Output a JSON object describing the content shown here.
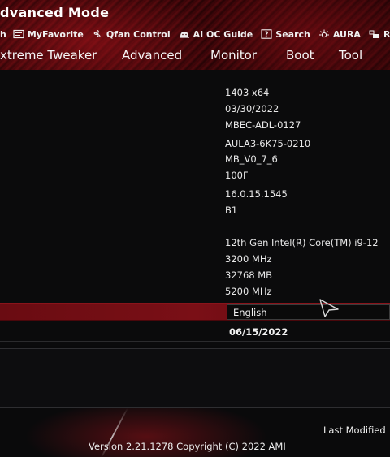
{
  "header": {
    "title": "dvanced Mode"
  },
  "toolbar": {
    "items": [
      {
        "label": "h",
        "icon": "none"
      },
      {
        "label": "MyFavorite",
        "icon": "myfavorite-icon"
      },
      {
        "label": "Qfan Control",
        "icon": "fan-icon"
      },
      {
        "label": "AI OC Guide",
        "icon": "ai-oc-icon"
      },
      {
        "label": "Search",
        "icon": "search-icon"
      },
      {
        "label": "AURA",
        "icon": "aura-icon"
      },
      {
        "label": "Re",
        "icon": "resize-bar-icon"
      }
    ]
  },
  "tabs": [
    {
      "label": "xtreme Tweaker"
    },
    {
      "label": "Advanced"
    },
    {
      "label": "Monitor"
    },
    {
      "label": "Boot"
    },
    {
      "label": "Tool"
    }
  ],
  "info_values": [
    "1403  x64",
    "03/30/2022",
    "MBEC-ADL-0127",
    "AULA3-6K75-0210",
    "MB_V0_7_6",
    "100F",
    "16.0.15.1545",
    "B1",
    "12th Gen Intel(R) Core(TM) i9-12",
    "3200 MHz",
    "32768 MB",
    " 5200 MHz"
  ],
  "language": {
    "selected": "English"
  },
  "system_date": "06/15/2022",
  "footer": {
    "last_modified": "Last Modified",
    "version": "Version 2.21.1278 Copyright (C) 2022 AMI"
  },
  "colors": {
    "accent_red": "#7a0f16",
    "background": "#0b0b0c",
    "text": "#f2f2f2"
  }
}
